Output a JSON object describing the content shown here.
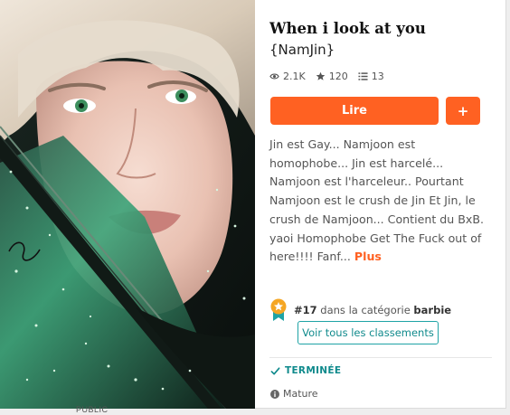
{
  "story": {
    "title": "When i look at you",
    "subtitle": "{NamJin}",
    "stats": {
      "reads": "2.1K",
      "votes": "120",
      "parts": "13"
    },
    "read_button": "Lire",
    "add_button": "+",
    "description": "Jin est Gay... Namjoon est homophobe... Jin est harcelé... Namjoon est l'harceleur.. Pourtant Namjoon est le crush de Jin Et Jin, le crush de Namjoon... Contient du BxB. yaoi Homophobe Get The Fuck out of here!!!! Fanf...",
    "more_link": "Plus"
  },
  "ranking": {
    "rank": "#17",
    "text": "dans la catégorie",
    "category": "barbie",
    "see_all_button": "Voir tous les classements"
  },
  "status": {
    "completed": "TERMINÉE",
    "mature": "Mature"
  },
  "cover": {
    "bottom_label": "PUBLIC"
  },
  "colors": {
    "accent": "#ff6122",
    "teal": "#1ea3a5"
  },
  "icons": {
    "reads": "eye-icon",
    "votes": "star-icon",
    "parts": "list-icon",
    "status": "check-icon",
    "mature": "info-icon",
    "rank": "rank-ribbon-icon"
  }
}
